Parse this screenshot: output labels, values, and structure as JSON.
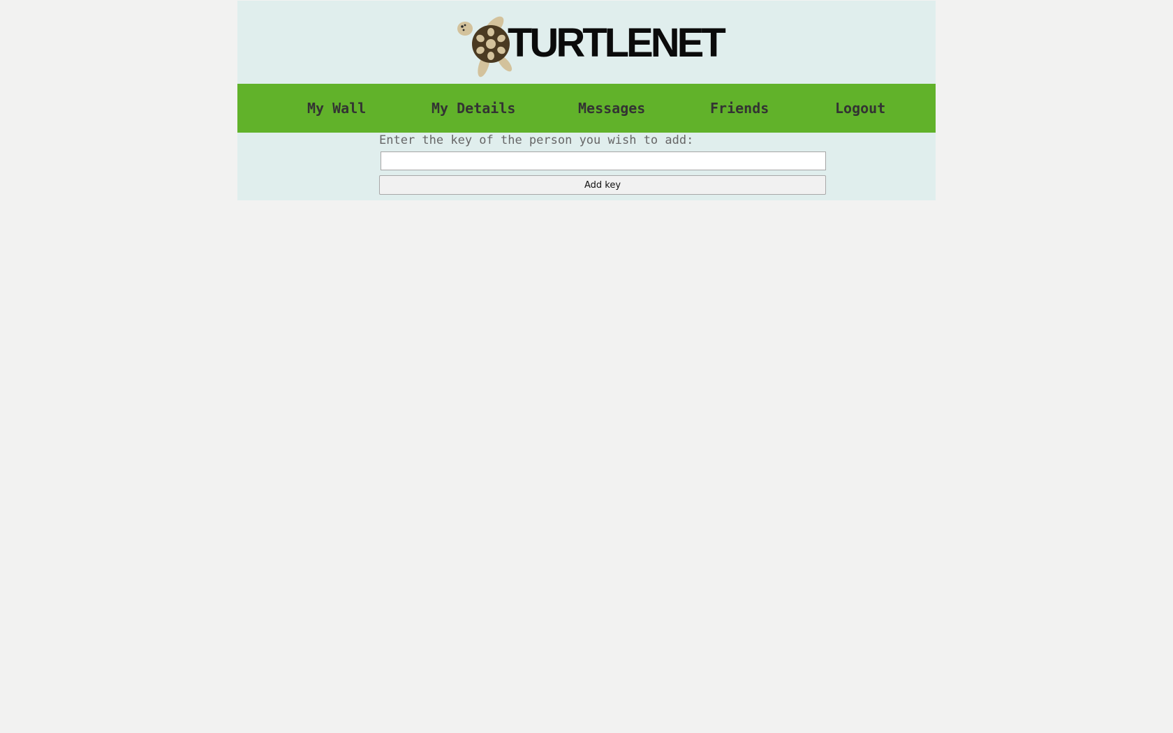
{
  "brand": {
    "logo_text": "TURTLENET",
    "logo_icon": "turtle-icon"
  },
  "nav": {
    "items": [
      {
        "label": "My Wall"
      },
      {
        "label": "My Details"
      },
      {
        "label": "Messages"
      },
      {
        "label": "Friends"
      },
      {
        "label": "Logout"
      }
    ]
  },
  "add_friend": {
    "prompt": "Enter the key of the person you wish to add:",
    "key_value": "",
    "key_placeholder": "",
    "button_label": "Add key"
  },
  "colors": {
    "nav_background": "#61b22a",
    "panel_background": "#e0eeed",
    "page_background": "#f2f2f1"
  }
}
